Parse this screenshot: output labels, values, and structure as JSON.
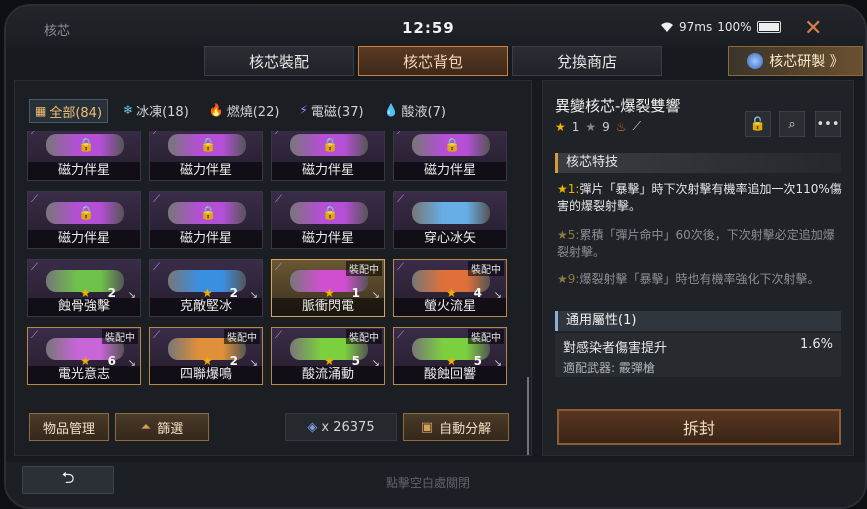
{
  "window": {
    "title": "核芯",
    "clock": "12:59",
    "ping": "97ms",
    "battery": "100%"
  },
  "tabs": [
    {
      "label": "核芯裝配"
    },
    {
      "label": "核芯背包"
    },
    {
      "label": "兌換商店"
    }
  ],
  "research_label": "核芯研製 》",
  "filters": [
    {
      "icon": "▦",
      "label": "全部(84)"
    },
    {
      "icon": "❄",
      "label": "冰凍(18)"
    },
    {
      "icon": "🔥",
      "label": "燃燒(22)"
    },
    {
      "icon": "⚡",
      "label": "電磁(37)"
    },
    {
      "icon": "💧",
      "label": "酸液(7)"
    }
  ],
  "cores": [
    {
      "name": "磁力伴星",
      "locked": true,
      "color": "#b44fd6"
    },
    {
      "name": "磁力伴星",
      "locked": true,
      "color": "#b44fd6"
    },
    {
      "name": "磁力伴星",
      "locked": true,
      "color": "#b44fd6"
    },
    {
      "name": "磁力伴星",
      "locked": true,
      "color": "#b44fd6"
    },
    {
      "name": "磁力伴星",
      "locked": true,
      "color": "#b44fd6"
    },
    {
      "name": "磁力伴星",
      "locked": true,
      "color": "#b44fd6"
    },
    {
      "name": "磁力伴星",
      "locked": true,
      "color": "#b44fd6"
    },
    {
      "name": "穿心冰矢",
      "locked": false,
      "color": "#67aee6"
    },
    {
      "name": "蝕骨強擊",
      "level": "2",
      "color": "#6ec24c"
    },
    {
      "name": "克敵堅冰",
      "level": "2",
      "color": "#3b8fe0"
    },
    {
      "name": "脈衝閃電",
      "level": "1",
      "badge": "裝配中",
      "highlight": true,
      "color": "#d04fd0"
    },
    {
      "name": "螢火流星",
      "level": "4",
      "badge": "裝配中",
      "color": "#e0703a"
    },
    {
      "name": "電光意志",
      "level": "6",
      "badge": "裝配中",
      "color": "#c865d8"
    },
    {
      "name": "四聯爆鳴",
      "level": "2",
      "badge": "裝配中",
      "color": "#e0903a"
    },
    {
      "name": "酸流涌動",
      "level": "5",
      "badge": "裝配中",
      "color": "#7ccf3e"
    },
    {
      "name": "酸蝕回響",
      "level": "5",
      "badge": "裝配中",
      "color": "#7ccf3e"
    }
  ],
  "buttons": {
    "manage": "物品管理",
    "filter": "篩選",
    "auto": "自動分解"
  },
  "resource": {
    "amount": "x 26375"
  },
  "detail": {
    "title": "異變核芯-爆裂雙響",
    "star_level": "1",
    "gray_star_level": "9",
    "section_skills": "核芯特技",
    "skills": [
      {
        "star": "★1:",
        "text": "彈片「暴擊」時下次射擊有機率追加一次110%傷害的爆裂射擊。",
        "active": true
      },
      {
        "star": "★5:",
        "text": "累積「彈片命中」60次後，下次射擊必定追加爆裂射擊。",
        "active": false
      },
      {
        "star": "★9:",
        "text": "爆裂射擊「暴擊」時也有機率強化下次射擊。",
        "active": false
      }
    ],
    "attr_head": "通用屬性(1)",
    "attr_name": "對感染者傷害提升",
    "attr_value": "1.6%",
    "attr_weapon": "適配武器: 霰彈槍",
    "unseal": "拆封"
  },
  "footer": {
    "hint": "點擊空白處關閉"
  }
}
